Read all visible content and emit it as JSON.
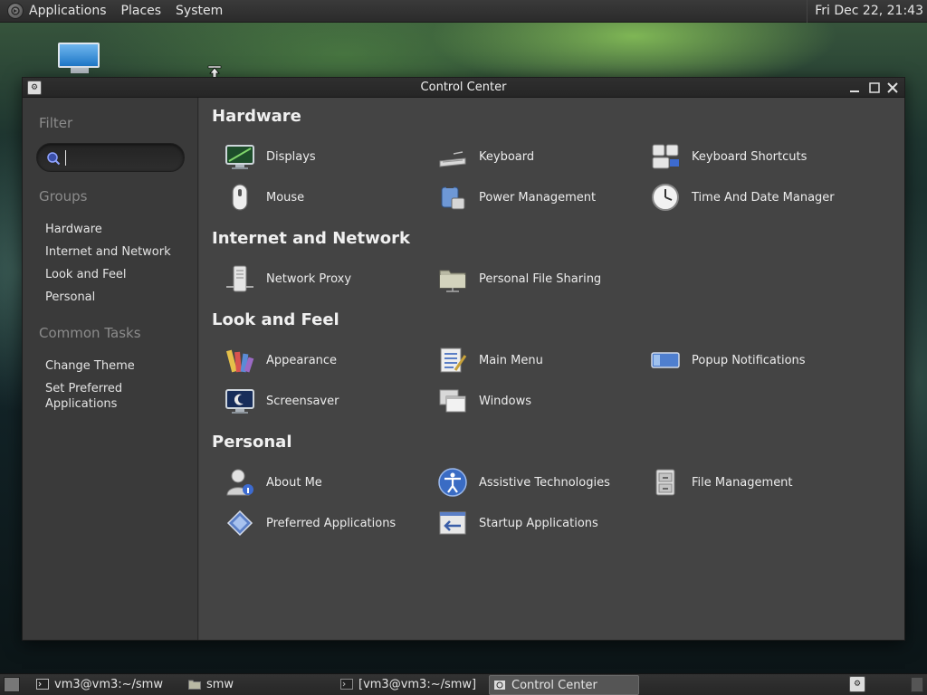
{
  "top_panel": {
    "menus": [
      "Applications",
      "Places",
      "System"
    ],
    "clock": "Fri Dec 22, 21:43"
  },
  "window": {
    "title": "Control Center"
  },
  "sidebar": {
    "filter_heading": "Filter",
    "search_value": "",
    "groups_heading": "Groups",
    "groups": [
      "Hardware",
      "Internet and Network",
      "Look and Feel",
      "Personal"
    ],
    "tasks_heading": "Common Tasks",
    "tasks": [
      "Change Theme",
      "Set Preferred Applications"
    ]
  },
  "sections": [
    {
      "title": "Hardware",
      "items": [
        {
          "label": "Displays",
          "icon": "display-icon"
        },
        {
          "label": "Keyboard",
          "icon": "keyboard-icon"
        },
        {
          "label": "Keyboard Shortcuts",
          "icon": "keyboard-shortcuts-icon"
        },
        {
          "label": "Mouse",
          "icon": "mouse-icon"
        },
        {
          "label": "Power Management",
          "icon": "power-management-icon"
        },
        {
          "label": "Time And Date Manager",
          "icon": "clock-icon"
        }
      ]
    },
    {
      "title": "Internet and Network",
      "items": [
        {
          "label": "Network Proxy",
          "icon": "network-proxy-icon"
        },
        {
          "label": "Personal File Sharing",
          "icon": "folder-share-icon"
        }
      ]
    },
    {
      "title": "Look and Feel",
      "items": [
        {
          "label": "Appearance",
          "icon": "appearance-icon"
        },
        {
          "label": "Main Menu",
          "icon": "main-menu-icon"
        },
        {
          "label": "Popup Notifications",
          "icon": "notification-icon"
        },
        {
          "label": "Screensaver",
          "icon": "screensaver-icon"
        },
        {
          "label": "Windows",
          "icon": "windows-icon"
        }
      ]
    },
    {
      "title": "Personal",
      "items": [
        {
          "label": "About Me",
          "icon": "about-me-icon"
        },
        {
          "label": "Assistive Technologies",
          "icon": "accessibility-icon"
        },
        {
          "label": "File Management",
          "icon": "file-cabinet-icon"
        },
        {
          "label": "Preferred Applications",
          "icon": "preferred-apps-icon"
        },
        {
          "label": "Startup Applications",
          "icon": "startup-apps-icon"
        }
      ]
    }
  ],
  "taskbar": {
    "tasks": [
      "vm3@vm3:~/smw",
      "smw",
      "[vm3@vm3:~/smw]",
      "Control Center"
    ],
    "active_index": 3
  }
}
